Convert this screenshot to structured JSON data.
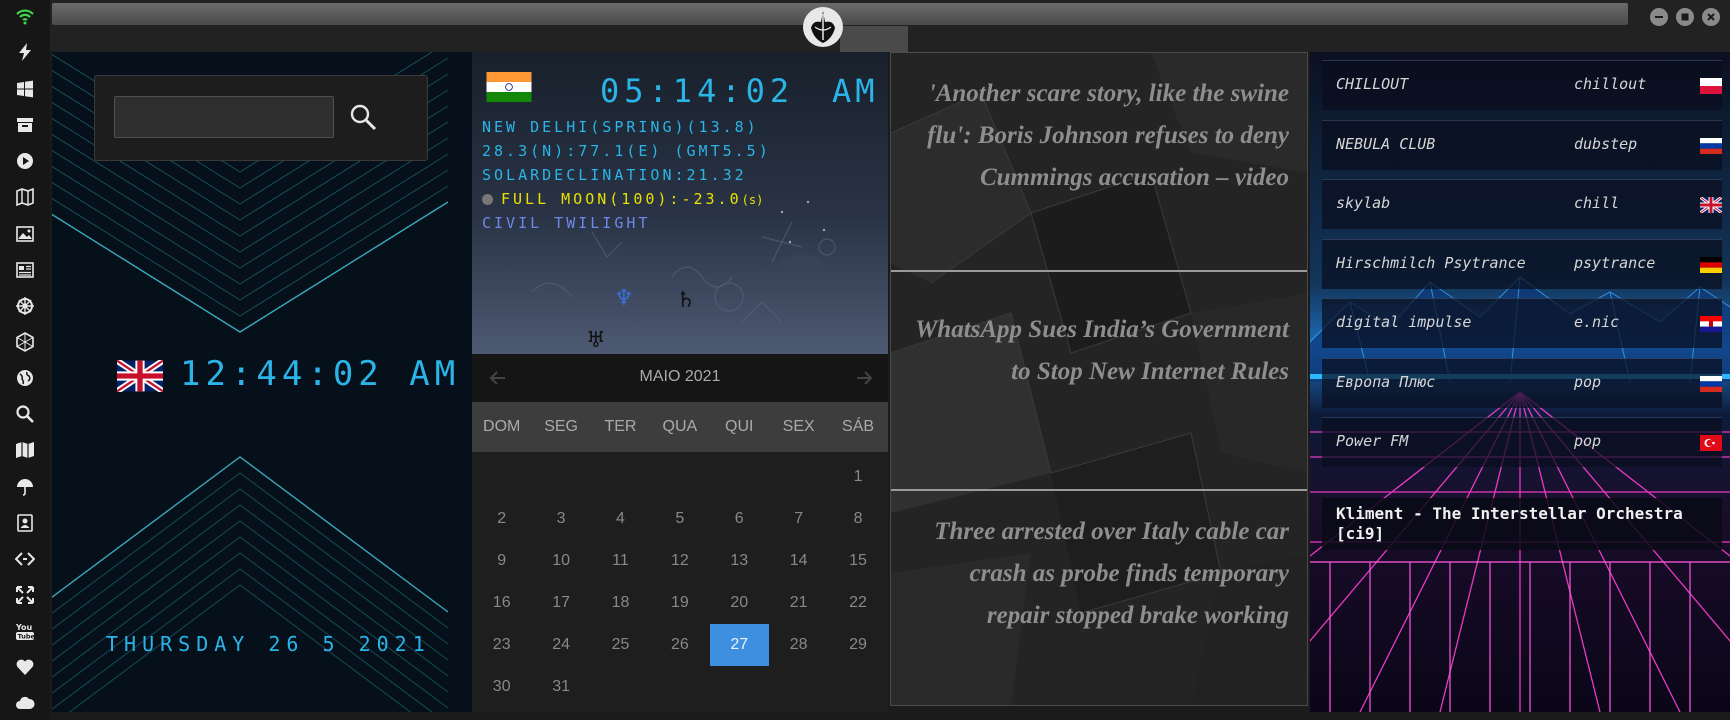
{
  "sidebar": {
    "icons": [
      "wifi-icon",
      "lightning-icon",
      "windows-icon",
      "archive-icon",
      "play-icon",
      "map-book-icon",
      "image-icon",
      "news-icon",
      "helm-icon",
      "hexagon-icon",
      "globe-icon",
      "search-icon",
      "map-icon",
      "umbrella-icon",
      "contacts-icon",
      "code-icon",
      "fullscreen-icon",
      "youtube-icon",
      "heart-icon",
      "cloud-icon"
    ]
  },
  "world_clock": {
    "search_placeholder": "",
    "time": "12:44:02 AM",
    "date": "THURSDAY 26 5 2021"
  },
  "astro": {
    "time": "05:14:02",
    "ampm": "AM",
    "line1": "NEW DELHI(SPRING)(13.8)",
    "line2": "28.3(N):77.1(E) (GMT5.5)",
    "line3": "SOLARDECLINATION:21.32",
    "moon": "FULL MOON(100):-23.0",
    "moon_suffix": "(s)",
    "twilight": "CIVIL TWILIGHT",
    "planets": [
      "♆",
      "♄",
      "♅"
    ]
  },
  "calendar": {
    "title": "MAIO 2021",
    "days_of_week": [
      "DOM",
      "SEG",
      "TER",
      "QUA",
      "QUI",
      "SEX",
      "SÁB"
    ],
    "weeks": [
      [
        "",
        "",
        "",
        "",
        "",
        "",
        "1"
      ],
      [
        "2",
        "3",
        "4",
        "5",
        "6",
        "7",
        "8"
      ],
      [
        "9",
        "10",
        "11",
        "12",
        "13",
        "14",
        "15"
      ],
      [
        "16",
        "17",
        "18",
        "19",
        "20",
        "21",
        "22"
      ],
      [
        "23",
        "24",
        "25",
        "26",
        "27",
        "28",
        "29"
      ],
      [
        "30",
        "31",
        "",
        "",
        "",
        "",
        ""
      ]
    ],
    "selected_day": "27",
    "accent": "#3f8fe0"
  },
  "news": {
    "items": [
      "'Another scare story, like the swine flu': Boris Johnson refuses to deny Cummings accusation – video",
      "WhatsApp Sues India’s Government to Stop New Internet Rules",
      "Three arrested over Italy cable car crash as probe finds temporary repair stopped brake working"
    ]
  },
  "radio": {
    "stations": [
      {
        "name": "CHILLOUT",
        "genre": "chillout",
        "flag": "poland"
      },
      {
        "name": "NEBULA CLUB",
        "genre": "dubstep",
        "flag": "russia"
      },
      {
        "name": "skylab",
        "genre": "chill",
        "flag": "uk"
      },
      {
        "name": "Hirschmilch Psytrance",
        "genre": "psytrance",
        "flag": "germany"
      },
      {
        "name": "digital impulse",
        "genre": "e.nic",
        "flag": "croatia"
      },
      {
        "name": "Европа Плюс",
        "genre": "pop",
        "flag": "russia"
      },
      {
        "name": "Power FM",
        "genre": "pop",
        "flag": "turkey"
      }
    ],
    "now_playing": "Kliment - The Interstellar Orchestra [ci9]"
  },
  "colors": {
    "clock_blue": "#2ab4e8",
    "moon_yellow": "#e8e000",
    "twilight_blue": "#6f88e8",
    "wifi_green": "#3fd64b"
  }
}
